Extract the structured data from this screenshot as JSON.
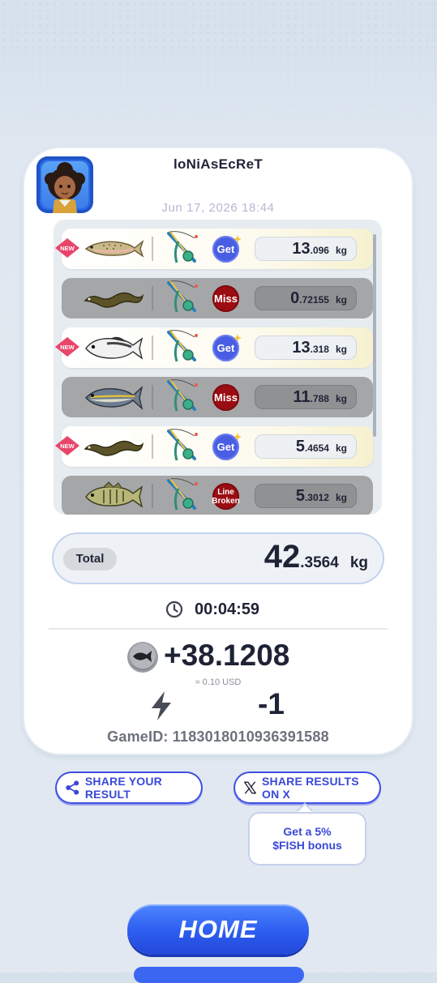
{
  "card": {
    "username": "loNiAsEcReT",
    "datetime": "Jun 17, 2026 18:44"
  },
  "catches": [
    {
      "is_new": true,
      "new_label": "NEW",
      "status": "Get",
      "fish_icon": "trout-icon",
      "weight_int": "13",
      "weight_dec": ".096",
      "unit": "kg"
    },
    {
      "is_new": false,
      "new_label": "",
      "status": "Miss",
      "fish_icon": "eel-icon",
      "weight_int": "0",
      "weight_dec": ".72155",
      "unit": "kg"
    },
    {
      "is_new": true,
      "new_label": "NEW",
      "status": "Get",
      "fish_icon": "grouper-icon",
      "weight_int": "13",
      "weight_dec": ".318",
      "unit": "kg"
    },
    {
      "is_new": false,
      "new_label": "",
      "status": "Miss",
      "fish_icon": "tuna-icon",
      "weight_int": "11",
      "weight_dec": ".788",
      "unit": "kg"
    },
    {
      "is_new": true,
      "new_label": "NEW",
      "status": "Get",
      "fish_icon": "eel-icon",
      "weight_int": "5",
      "weight_dec": ".4654",
      "unit": "kg"
    },
    {
      "is_new": false,
      "new_label": "",
      "status": "Line Broken",
      "fish_icon": "bass-icon",
      "weight_int": "5",
      "weight_dec": ".3012",
      "unit": "kg"
    }
  ],
  "total": {
    "label": "Total",
    "int": "42",
    "dec": ".3564",
    "unit": "kg"
  },
  "elapsed_time": "00:04:59",
  "reward": {
    "amount": "+38.1208",
    "usd": "≈ 0.10 USD",
    "energy": "-1"
  },
  "game_id": "GameID: 1183018010936391588",
  "actions": {
    "share_result": "SHARE YOUR RESULT",
    "share_x": "SHARE RESULTS ON X",
    "tooltip_line1": "Get a 5%",
    "tooltip_line2": "$FISH bonus",
    "home": "HOME"
  },
  "colors": {
    "accent_blue": "#3e4fe0",
    "get_badge": "#4a5ee3",
    "miss_badge": "#9b0d12",
    "new_badge": "#e8456a"
  }
}
